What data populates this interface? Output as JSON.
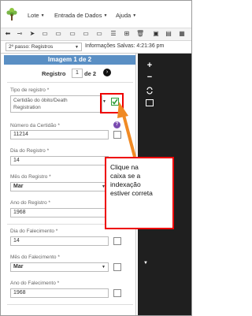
{
  "menu": {
    "items": [
      {
        "label": "Lote"
      },
      {
        "label": "Entrada de Dados"
      },
      {
        "label": "Ajuda"
      }
    ]
  },
  "stepbar": {
    "step_select": "2º passo: Registros",
    "saved_info": "Informações Salvas: 4:21:36 pm"
  },
  "panel": {
    "header": "Imagem 1 de 2",
    "record_label": "Registro",
    "record_value": "1",
    "record_total": "de 2"
  },
  "fields": {
    "tipo_registro": {
      "label": "Tipo de registro *",
      "value_line1": "Certidão do óbito/Death",
      "value_line2": "Registration"
    },
    "numero_certidao": {
      "label": "Número da Certidão *",
      "value": "11214"
    },
    "dia_registro": {
      "label": "Dia do Registro *",
      "value": "14"
    },
    "mes_registro": {
      "label": "Mês do Registro *",
      "value": "Mar"
    },
    "ano_registro": {
      "label": "Ano do Registro *",
      "value": "1968"
    },
    "dia_falecimento": {
      "label": "Dia do Falecimento *",
      "value": "14"
    },
    "mes_falecimento": {
      "label": "Mês do Falecimento *",
      "value": "Mar"
    },
    "ano_falecimento": {
      "label": "Ano do Falecimento *",
      "value": "1968"
    }
  },
  "callout": {
    "line1": "Clique na",
    "line2": "caixa se a",
    "line3": "indexação",
    "line4": "estiver correta"
  },
  "viewer": {
    "zoom_in": "+",
    "zoom_out": "−"
  },
  "colors": {
    "header_blue": "#5a8fc4",
    "highlight_red": "#e00000",
    "arrow_orange": "#f08a24",
    "checkmark_green": "#2e9e3a",
    "help_purple": "#7a4bb0",
    "viewer_bg": "#1f1f1f"
  }
}
